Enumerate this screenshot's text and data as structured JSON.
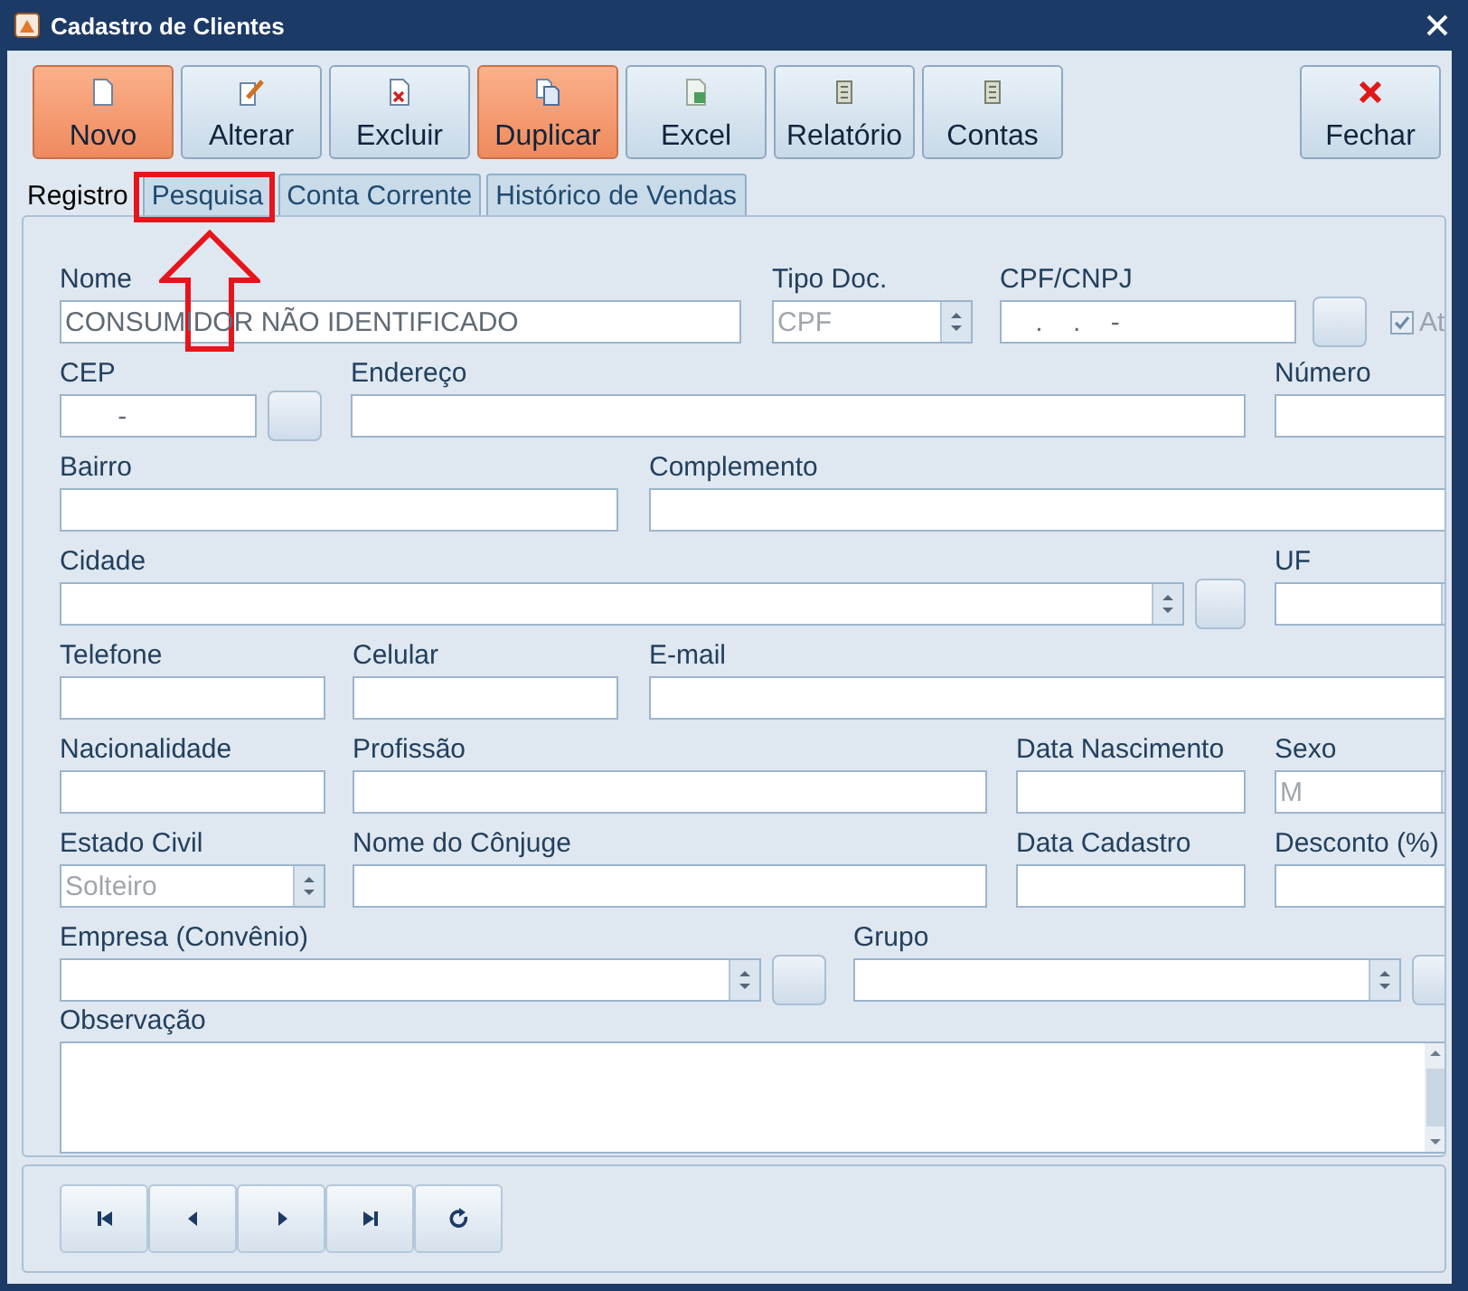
{
  "window": {
    "title": "Cadastro de Clientes"
  },
  "toolbar": [
    {
      "label": "Novo",
      "kind": "new",
      "highlighted": true
    },
    {
      "label": "Alterar",
      "kind": "edit",
      "highlighted": false
    },
    {
      "label": "Excluir",
      "kind": "delete",
      "highlighted": false
    },
    {
      "label": "Duplicar",
      "kind": "copy",
      "highlighted": true
    },
    {
      "label": "Excel",
      "kind": "excel",
      "highlighted": false
    },
    {
      "label": "Relatório",
      "kind": "report",
      "highlighted": false
    },
    {
      "label": "Contas",
      "kind": "report",
      "highlighted": false
    },
    {
      "label": "Fechar",
      "kind": "close",
      "highlighted": false
    }
  ],
  "tabs": [
    {
      "label": "Registro",
      "selected": true,
      "annotated": false
    },
    {
      "label": "Pesquisa",
      "selected": false,
      "annotated": true
    },
    {
      "label": "Conta Corrente",
      "selected": false,
      "annotated": false
    },
    {
      "label": "Histórico de Vendas",
      "selected": false,
      "annotated": false
    }
  ],
  "form": {
    "fields": [
      {
        "kind": "text",
        "label": "Nome",
        "value": "CONSUMIDOR NÃO IDENTIFICADO"
      },
      {
        "kind": "select",
        "label": "Tipo Doc.",
        "value": "CPF",
        "disabled": true
      },
      {
        "kind": "text",
        "label": "CPF/CNPJ",
        "value": "    .    .    -"
      },
      {
        "kind": "button"
      },
      {
        "kind": "checkbox",
        "label": "At",
        "checked": true,
        "disabled": true
      },
      {
        "kind": "text",
        "label": "CEP",
        "value": "       -"
      },
      {
        "kind": "button"
      },
      {
        "kind": "text",
        "label": "Endereço"
      },
      {
        "kind": "text",
        "label": "Número"
      },
      {
        "kind": "text",
        "label": "Bairro"
      },
      {
        "kind": "text",
        "label": "Complemento"
      },
      {
        "kind": "select",
        "label": "Cidade"
      },
      {
        "kind": "button"
      },
      {
        "kind": "select",
        "label": "UF"
      },
      {
        "kind": "text",
        "label": "Telefone"
      },
      {
        "kind": "text",
        "label": "Celular"
      },
      {
        "kind": "text",
        "label": "E-mail"
      },
      {
        "kind": "text",
        "label": "Nacionalidade"
      },
      {
        "kind": "text",
        "label": "Profissão"
      },
      {
        "kind": "text",
        "label": "Data Nascimento"
      },
      {
        "kind": "select",
        "label": "Sexo",
        "value": "M",
        "disabled": true
      },
      {
        "kind": "select",
        "label": "Estado Civil",
        "value": "Solteiro",
        "disabled": true
      },
      {
        "kind": "text",
        "label": "Nome do Cônjuge"
      },
      {
        "kind": "text",
        "label": "Data Cadastro"
      },
      {
        "kind": "text",
        "label": "Desconto (%)"
      },
      {
        "kind": "select",
        "label": "Empresa (Convênio)"
      },
      {
        "kind": "button"
      },
      {
        "kind": "select",
        "label": "Grupo"
      },
      {
        "kind": "button"
      },
      {
        "kind": "memo",
        "label": "Observação"
      }
    ]
  },
  "navigation": [
    {
      "kind": "first"
    },
    {
      "kind": "prev"
    },
    {
      "kind": "next"
    },
    {
      "kind": "last"
    },
    {
      "kind": "refresh"
    }
  ]
}
